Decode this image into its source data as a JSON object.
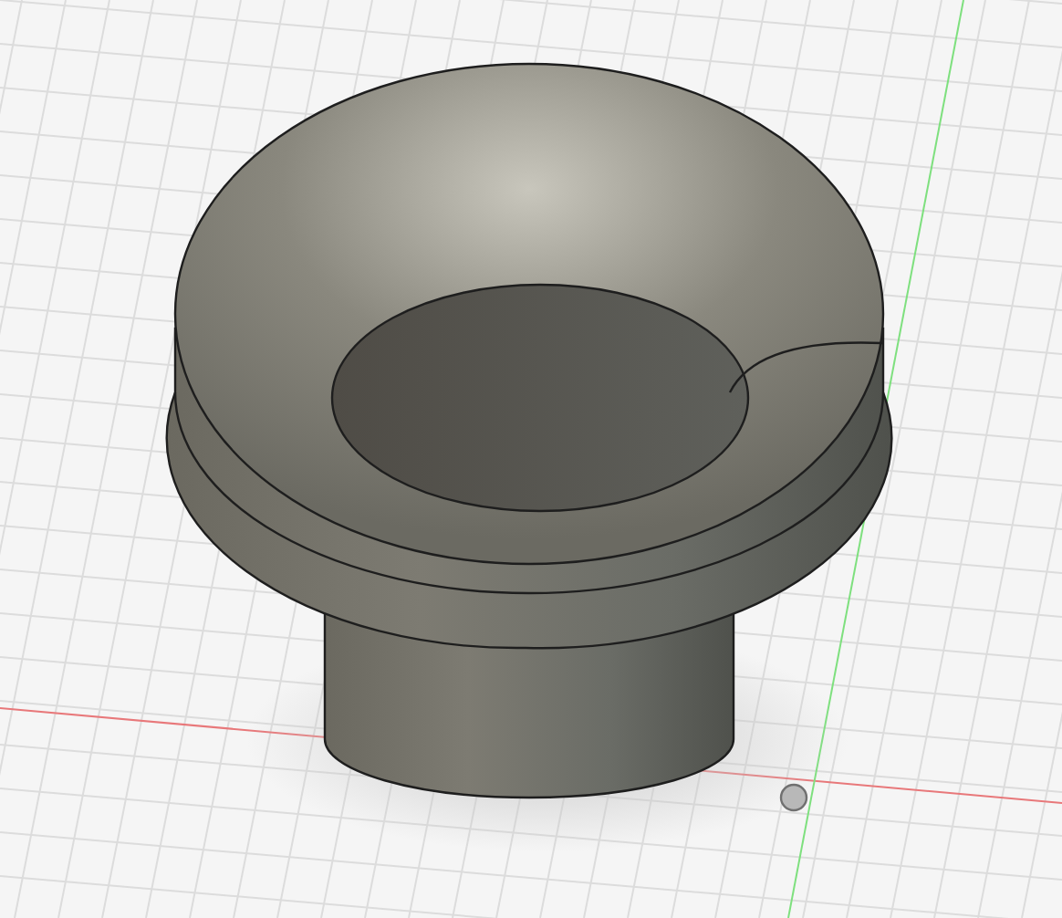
{
  "viewport": {
    "axes": [
      {
        "kind": "x",
        "color": "#e8787a"
      },
      {
        "kind": "y",
        "color": "#7ee07e"
      }
    ]
  }
}
